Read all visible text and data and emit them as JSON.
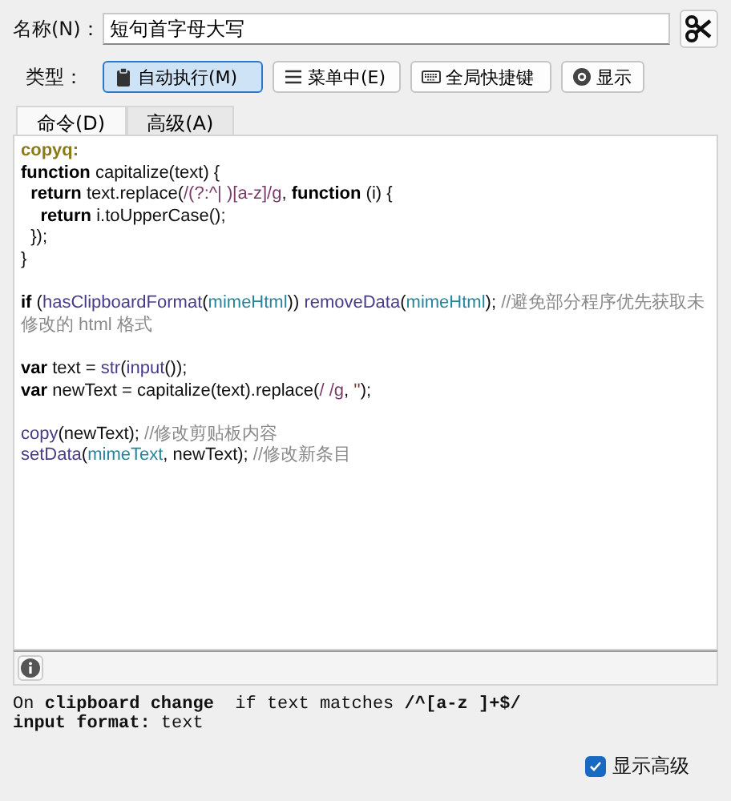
{
  "name_field": {
    "label": "名称(N)：",
    "value": "短句首字母大写"
  },
  "type_row": {
    "label": "类型：",
    "buttons": [
      {
        "kind": "clipboard",
        "label": "自动执行(M)",
        "selected": true
      },
      {
        "kind": "menu",
        "label": "菜单中(E)",
        "selected": false
      },
      {
        "kind": "keyboard",
        "label": "全局快捷键",
        "selected": false
      },
      {
        "kind": "eye",
        "label": "显示",
        "selected": false
      }
    ]
  },
  "tabs": [
    {
      "label": "命令(D)",
      "selected": true
    },
    {
      "label": "高级(A)",
      "selected": false
    }
  ],
  "code_lines": [
    {
      "kind": "code",
      "tokens": [
        {
          "kind": "label",
          "text": "copyq:"
        }
      ]
    },
    {
      "kind": "code",
      "tokens": [
        {
          "kind": "keyword",
          "text": "function"
        },
        {
          "kind": "plain",
          "text": " capitalize(text) {"
        }
      ]
    },
    {
      "kind": "code",
      "tokens": [
        {
          "kind": "keyword",
          "text": "  return"
        },
        {
          "kind": "plain",
          "text": " text.replace("
        },
        {
          "kind": "regex",
          "text": "/(?:^| )[a-z]/g"
        },
        {
          "kind": "plain",
          "text": ", "
        },
        {
          "kind": "keyword",
          "text": "function"
        },
        {
          "kind": "plain",
          "text": " (i) {"
        }
      ]
    },
    {
      "kind": "code",
      "tokens": [
        {
          "kind": "keyword",
          "text": "    return"
        },
        {
          "kind": "plain",
          "text": " i.toUpperCase();"
        }
      ]
    },
    {
      "kind": "code",
      "tokens": [
        {
          "kind": "plain",
          "text": "  });"
        }
      ]
    },
    {
      "kind": "code",
      "tokens": [
        {
          "kind": "plain",
          "text": "}"
        }
      ]
    },
    {
      "kind": "blank"
    },
    {
      "kind": "code",
      "tokens": [
        {
          "kind": "keyword",
          "text": "if"
        },
        {
          "kind": "plain",
          "text": " ("
        },
        {
          "kind": "func",
          "text": "hasClipboardFormat"
        },
        {
          "kind": "plain",
          "text": "("
        },
        {
          "kind": "ident",
          "text": "mimeHtml"
        },
        {
          "kind": "plain",
          "text": ")) "
        },
        {
          "kind": "func",
          "text": "removeData"
        },
        {
          "kind": "plain",
          "text": "("
        },
        {
          "kind": "ident",
          "text": "mimeHtml"
        },
        {
          "kind": "plain",
          "text": "); "
        },
        {
          "kind": "comment",
          "text": "//避免部分程序优先获取未修改的 html 格式"
        }
      ]
    },
    {
      "kind": "blank"
    },
    {
      "kind": "code",
      "tokens": [
        {
          "kind": "keyword",
          "text": "var"
        },
        {
          "kind": "plain",
          "text": " text = "
        },
        {
          "kind": "func",
          "text": "str"
        },
        {
          "kind": "plain",
          "text": "("
        },
        {
          "kind": "func",
          "text": "input"
        },
        {
          "kind": "plain",
          "text": "());"
        }
      ]
    },
    {
      "kind": "code",
      "tokens": [
        {
          "kind": "keyword",
          "text": "var"
        },
        {
          "kind": "plain",
          "text": " newText = capitalize(text).replace("
        },
        {
          "kind": "regex",
          "text": "/ /g"
        },
        {
          "kind": "plain",
          "text": ", "
        },
        {
          "kind": "string",
          "text": "''"
        },
        {
          "kind": "plain",
          "text": ");"
        }
      ]
    },
    {
      "kind": "blank"
    },
    {
      "kind": "code",
      "tokens": [
        {
          "kind": "func",
          "text": "copy"
        },
        {
          "kind": "plain",
          "text": "(newText); "
        },
        {
          "kind": "comment",
          "text": "//修改剪贴板内容"
        }
      ]
    },
    {
      "kind": "code",
      "tokens": [
        {
          "kind": "func",
          "text": "setData"
        },
        {
          "kind": "plain",
          "text": "("
        },
        {
          "kind": "ident",
          "text": "mimeText"
        },
        {
          "kind": "plain",
          "text": ", newText); "
        },
        {
          "kind": "comment",
          "text": "//修改新条目"
        }
      ]
    }
  ],
  "summary": [
    "On **clipboard change**  if text matches **/^[a-z ]+$/**",
    "**input format:** text"
  ],
  "show_advanced": {
    "label": "显示高级",
    "checked": true
  }
}
